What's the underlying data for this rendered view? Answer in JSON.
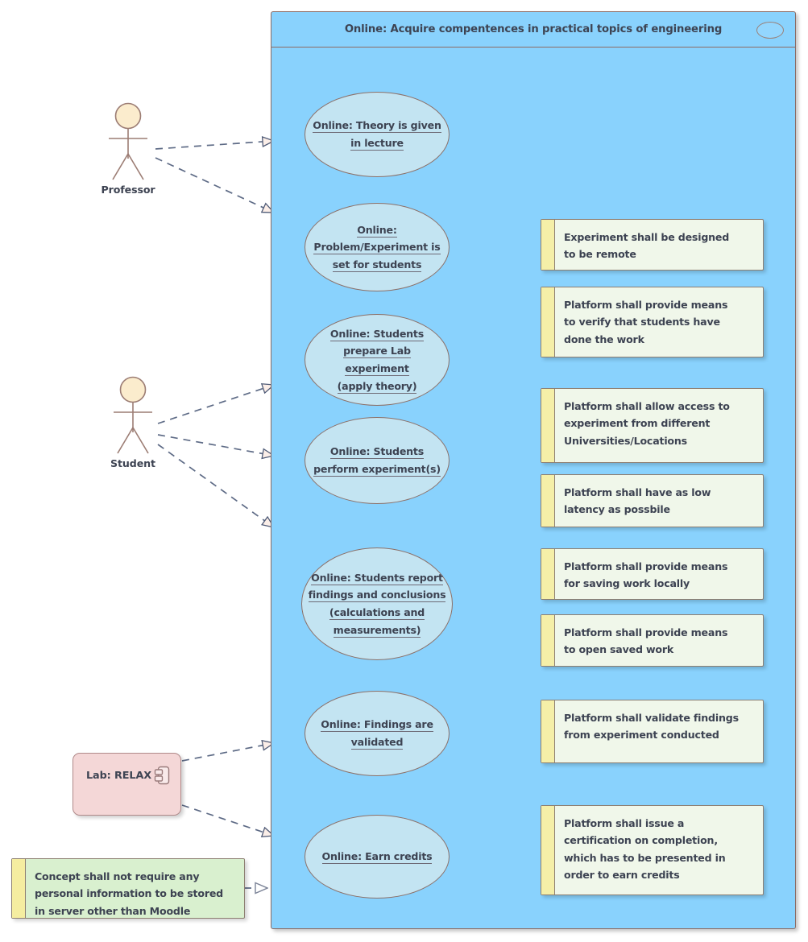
{
  "diagram": {
    "type": "uml-use-case-diagram",
    "boundary": {
      "title": "Online: Acquire compentences in practical topics of engineering",
      "badge_icon": "ellipse-icon"
    }
  },
  "actors": [
    {
      "name": "professor",
      "label": "Professor"
    },
    {
      "name": "student",
      "label": "Student"
    }
  ],
  "component": {
    "label": "Lab: RELAX",
    "icon": "component-icon"
  },
  "use_cases": [
    {
      "id": "uc-theory",
      "lines": [
        "Online: Theory is given",
        "in lecture"
      ]
    },
    {
      "id": "uc-problem",
      "lines": [
        "Online:",
        "Problem/Experiment is",
        "set for students"
      ]
    },
    {
      "id": "uc-prepare",
      "lines": [
        "Online: Students",
        "prepare Lab experiment",
        "(apply theory)"
      ]
    },
    {
      "id": "uc-perform",
      "lines": [
        "Online: Students",
        "perform experiment(s)"
      ]
    },
    {
      "id": "uc-report",
      "lines": [
        "Online: Students report",
        "findings and conclusions",
        "(calculations and",
        "measurements)"
      ]
    },
    {
      "id": "uc-validated",
      "lines": [
        "Online: Findings are",
        "validated"
      ]
    },
    {
      "id": "uc-credits",
      "lines": [
        "Online: Earn credits"
      ]
    }
  ],
  "notes": [
    {
      "id": "note-remote",
      "lines": [
        "Experiment shall be designed",
        "to be remote"
      ]
    },
    {
      "id": "note-verify",
      "lines": [
        "Platform shall provide means",
        "to verify that students have",
        "done the work"
      ]
    },
    {
      "id": "note-access",
      "lines": [
        "Platform shall allow access to",
        "experiment from different",
        "Universities/Locations"
      ]
    },
    {
      "id": "note-latency",
      "lines": [
        "Platform shall have as low",
        "latency as possbile"
      ]
    },
    {
      "id": "note-save",
      "lines": [
        "Platform shall provide means",
        "for saving work locally"
      ]
    },
    {
      "id": "note-open",
      "lines": [
        "Platform shall provide means",
        "to open saved work"
      ]
    },
    {
      "id": "note-validate",
      "lines": [
        "Platform shall validate findings",
        "from experiment conducted"
      ]
    },
    {
      "id": "note-certificate",
      "lines": [
        "Platform shall issue a",
        "certification on completion,",
        "which has to be presented in",
        "order to earn credits"
      ]
    },
    {
      "id": "note-privacy",
      "lines": [
        "Concept shall not require any",
        "personal information to be stored",
        "in server other than Moodle"
      ]
    }
  ],
  "colors": {
    "boundary_fill": "#89d2fd",
    "usecase_fill": "#c3e4f2",
    "note_fill": "#f0f7ea",
    "note_fill_green": "#d9f0cf",
    "note_stripe": "#f5efa8",
    "component_fill": "#f4d7d7",
    "actor_head_fill": "#fbeccd",
    "line_color": "#5e6b86",
    "text_color": "#3d4352",
    "border_color": "#8c7068"
  }
}
